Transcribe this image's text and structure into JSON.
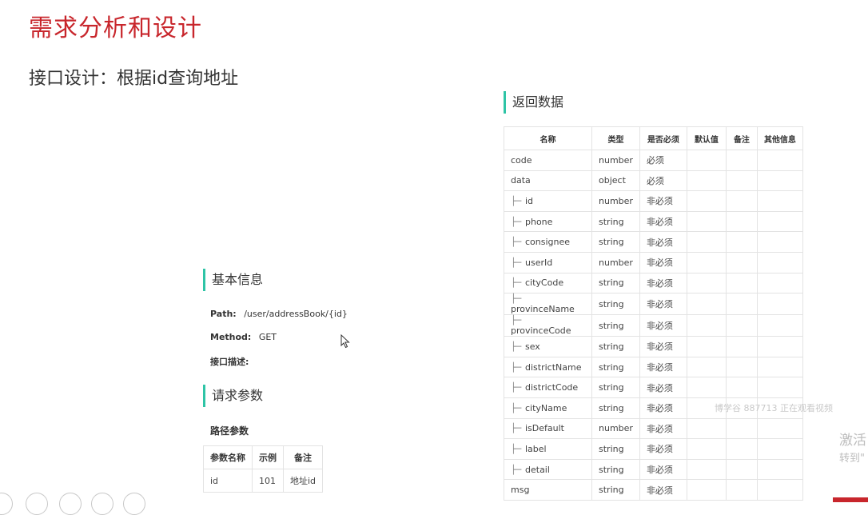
{
  "slide": {
    "title": "需求分析和设计",
    "subtitle": "接口设计：根据id查询地址"
  },
  "basic": {
    "heading": "基本信息",
    "path_label": "Path:",
    "path_value": "/user/addressBook/{id}",
    "method_label": "Method:",
    "method_value": "GET",
    "desc_label": "接口描述:"
  },
  "request": {
    "heading": "请求参数",
    "path_params_label": "路径参数",
    "columns": [
      "参数名称",
      "示例",
      "备注"
    ],
    "rows": [
      [
        "id",
        "101",
        "地址id"
      ]
    ]
  },
  "response": {
    "heading": "返回数据",
    "columns": [
      "名称",
      "类型",
      "是否必须",
      "默认值",
      "备注",
      "其他信息"
    ],
    "rows": [
      {
        "name": "code",
        "type": "number",
        "required": "必须",
        "child": false
      },
      {
        "name": "data",
        "type": "object",
        "required": "必须",
        "child": false
      },
      {
        "name": "id",
        "type": "number",
        "required": "非必须",
        "child": true
      },
      {
        "name": "phone",
        "type": "string",
        "required": "非必须",
        "child": true
      },
      {
        "name": "consignee",
        "type": "string",
        "required": "非必须",
        "child": true
      },
      {
        "name": "userId",
        "type": "number",
        "required": "非必须",
        "child": true
      },
      {
        "name": "cityCode",
        "type": "string",
        "required": "非必须",
        "child": true
      },
      {
        "name": "provinceName",
        "type": "string",
        "required": "非必须",
        "child": true
      },
      {
        "name": "provinceCode",
        "type": "string",
        "required": "非必须",
        "child": true
      },
      {
        "name": "sex",
        "type": "string",
        "required": "非必须",
        "child": true
      },
      {
        "name": "districtName",
        "type": "string",
        "required": "非必须",
        "child": true
      },
      {
        "name": "districtCode",
        "type": "string",
        "required": "非必须",
        "child": true
      },
      {
        "name": "cityName",
        "type": "string",
        "required": "非必须",
        "child": true
      },
      {
        "name": "isDefault",
        "type": "number",
        "required": "非必须",
        "child": true
      },
      {
        "name": "label",
        "type": "string",
        "required": "非必须",
        "child": true
      },
      {
        "name": "detail",
        "type": "string",
        "required": "非必须",
        "child": true
      },
      {
        "name": "msg",
        "type": "string",
        "required": "非必须",
        "child": false
      }
    ]
  },
  "overlay": {
    "watermark": "博学谷 887713 正在观看视频",
    "activate_line1": "激活",
    "activate_line2": "转到\""
  },
  "colors": {
    "title": "#c8262c",
    "accent": "#2ec4a6"
  }
}
